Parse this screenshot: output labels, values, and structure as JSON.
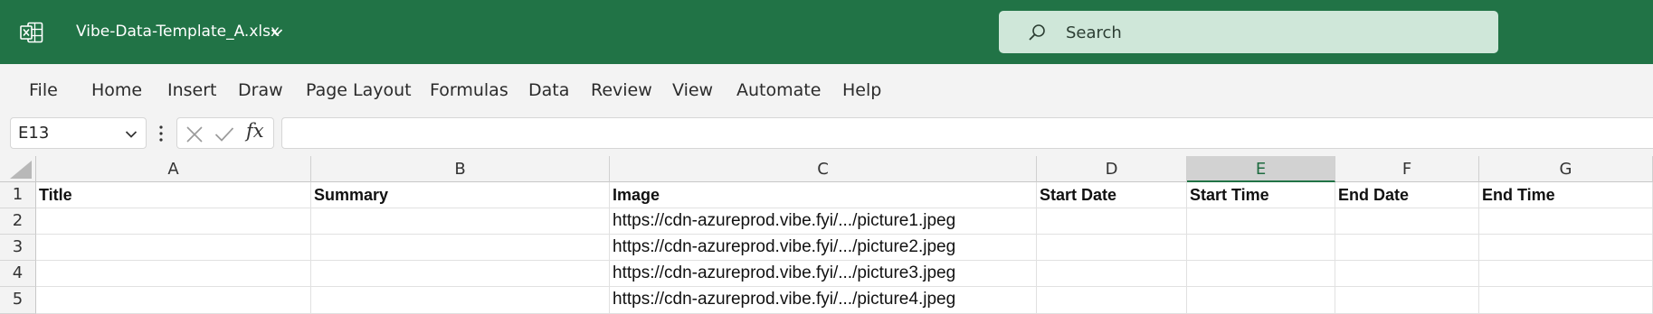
{
  "titlebar": {
    "app_icon": "excel-icon",
    "file_name": "Vibe-Data-Template_A.xlsx",
    "search_placeholder": "Search",
    "accent_color": "#217346"
  },
  "menu": {
    "items": [
      "File",
      "Home",
      "Insert",
      "Draw",
      "Page Layout",
      "Formulas",
      "Data",
      "Review",
      "View",
      "Automate",
      "Help"
    ]
  },
  "formula_bar": {
    "name_box": "E13",
    "fx_label": "fx",
    "formula_value": ""
  },
  "grid": {
    "columns": [
      "A",
      "B",
      "C",
      "D",
      "E",
      "F",
      "G"
    ],
    "selected_column": "E",
    "rows": [
      "1",
      "2",
      "3",
      "4",
      "5"
    ],
    "cells": [
      [
        "Title",
        "Summary",
        "Image",
        "Start Date",
        "Start Time",
        "End Date",
        "End Time"
      ],
      [
        "",
        "",
        "https://cdn-azureprod.vibe.fyi/.../picture1.jpeg",
        "",
        "",
        "",
        ""
      ],
      [
        "",
        "",
        "https://cdn-azureprod.vibe.fyi/.../picture2.jpeg",
        "",
        "",
        "",
        ""
      ],
      [
        "",
        "",
        "https://cdn-azureprod.vibe.fyi/.../picture3.jpeg",
        "",
        "",
        "",
        ""
      ],
      [
        "",
        "",
        "https://cdn-azureprod.vibe.fyi/.../picture4.jpeg",
        "",
        "",
        "",
        ""
      ]
    ]
  }
}
